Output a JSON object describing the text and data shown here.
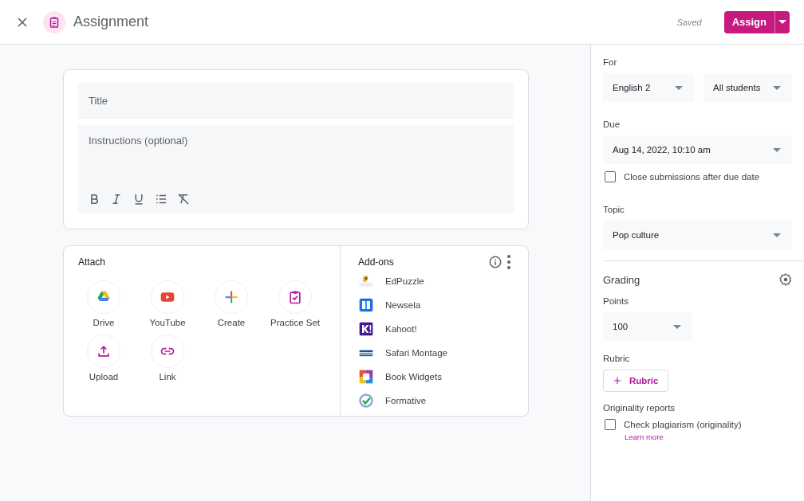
{
  "header": {
    "title": "Assignment",
    "status": "Saved",
    "primary_button": "Assign"
  },
  "editor": {
    "title_placeholder": "Title",
    "instructions_placeholder": "Instructions (optional)",
    "format_tools": [
      {
        "kind": "bold"
      },
      {
        "kind": "italic"
      },
      {
        "kind": "underline"
      },
      {
        "kind": "list"
      },
      {
        "kind": "clear"
      }
    ]
  },
  "attach": {
    "heading": "Attach",
    "items": [
      {
        "kind": "drive",
        "label": "Drive"
      },
      {
        "kind": "youtube",
        "label": "YouTube"
      },
      {
        "kind": "create",
        "label": "Create"
      },
      {
        "kind": "practice",
        "label": "Practice Set"
      },
      {
        "kind": "upload",
        "label": "Upload"
      },
      {
        "kind": "link",
        "label": "Link"
      }
    ]
  },
  "addons": {
    "heading": "Add-ons",
    "items": [
      {
        "kind": "edpuzzle",
        "label": "EdPuzzle"
      },
      {
        "kind": "newsela",
        "label": "Newsela"
      },
      {
        "kind": "kahoot",
        "label": "Kahoot!"
      },
      {
        "kind": "safari",
        "label": "Safari Montage"
      },
      {
        "kind": "bookwidgets",
        "label": "Book Widgets"
      },
      {
        "kind": "formative",
        "label": "Formative"
      }
    ]
  },
  "settings": {
    "for_label": "For",
    "class": "English 2",
    "students": "All students",
    "due_label": "Due",
    "due": "Aug 14, 2022, 10:10 am",
    "close_after_due": {
      "label": "Close submissions after due date",
      "checked": false
    },
    "topic_label": "Topic",
    "topic": "Pop culture",
    "grading_heading": "Grading",
    "points_label": "Points",
    "points": "100",
    "rubric_label": "Rubric",
    "rubric_button": "Rubric",
    "originality_label": "Originality reports",
    "plagiarism": {
      "label": "Check plagiarism (originality)",
      "checked": false
    },
    "learn_more": "Learn more"
  }
}
